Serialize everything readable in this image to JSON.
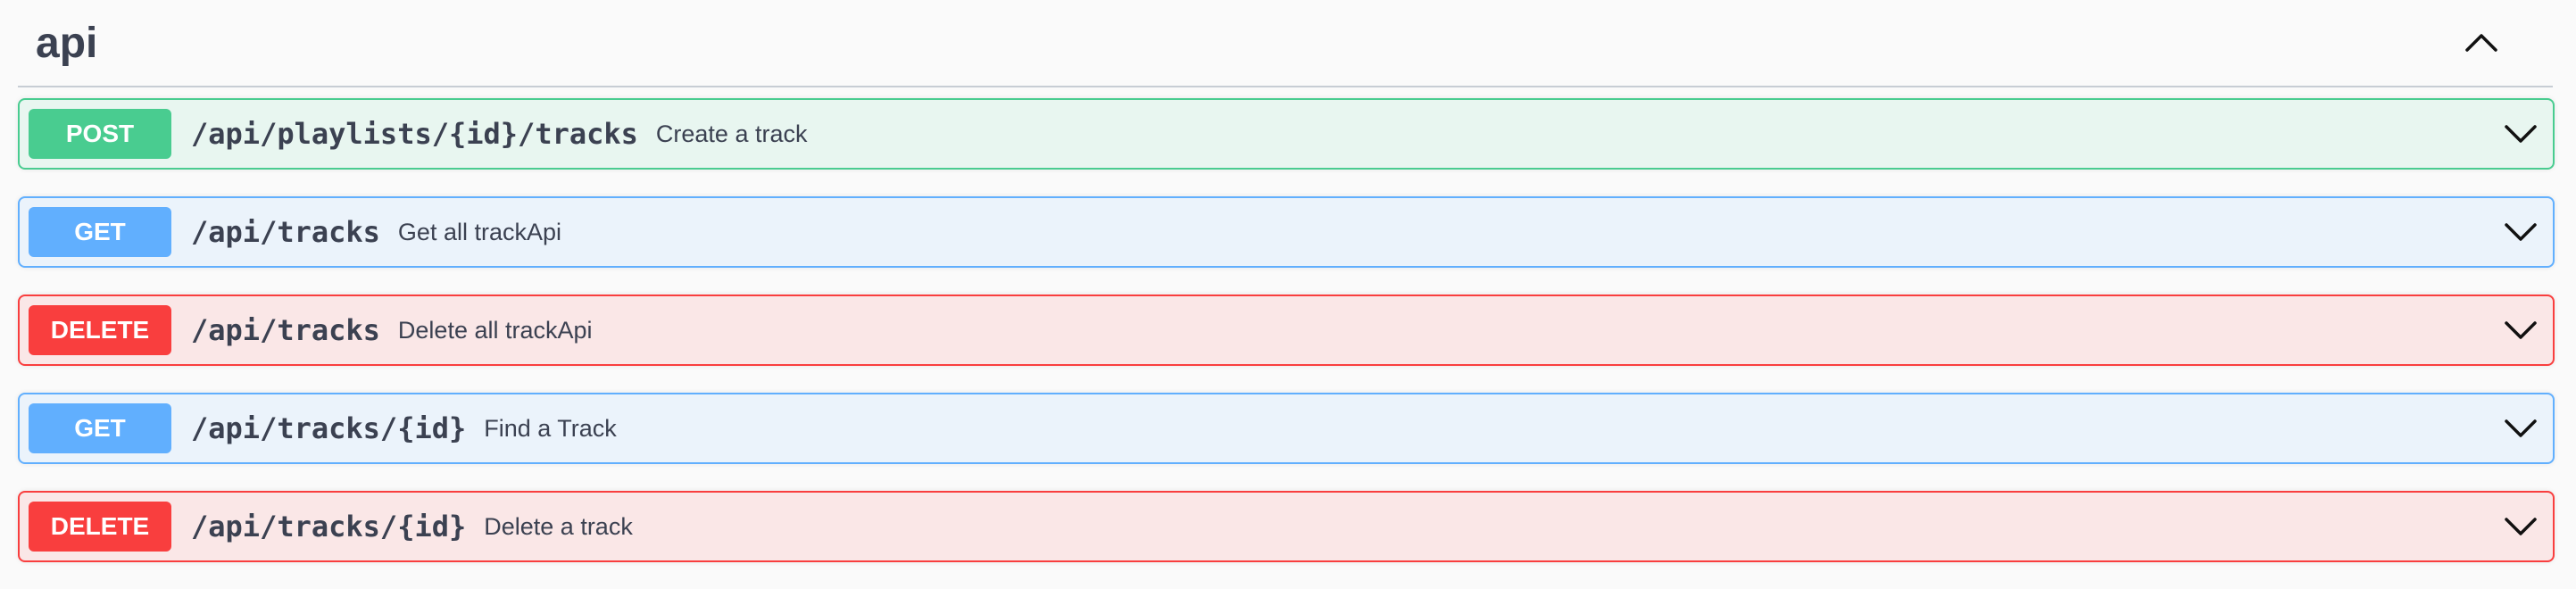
{
  "section": {
    "title": "api",
    "collapse_icon": "chevron-up-icon"
  },
  "operations": [
    {
      "method": "POST",
      "path": "/api/playlists/{id}/tracks",
      "summary": "Create a track",
      "kind": "post"
    },
    {
      "method": "GET",
      "path": "/api/tracks",
      "summary": "Get all trackApi",
      "kind": "get"
    },
    {
      "method": "DELETE",
      "path": "/api/tracks",
      "summary": "Delete all trackApi",
      "kind": "delete"
    },
    {
      "method": "GET",
      "path": "/api/tracks/{id}",
      "summary": "Find a Track",
      "kind": "get"
    },
    {
      "method": "DELETE",
      "path": "/api/tracks/{id}",
      "summary": "Delete a track",
      "kind": "delete"
    }
  ],
  "colors": {
    "post": "#49cc90",
    "get": "#61affe",
    "delete": "#f93e3e",
    "text": "#3b4151"
  }
}
